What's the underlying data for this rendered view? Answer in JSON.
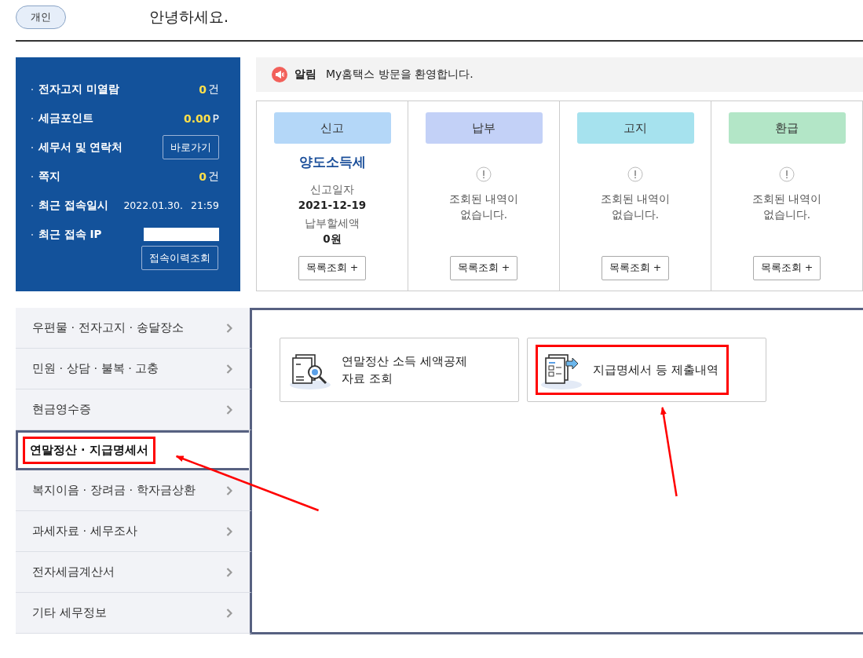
{
  "profile_tab": {
    "label": "개인",
    "selected": true
  },
  "greeting": "안녕하세요.",
  "summary": [
    {
      "kind": "count",
      "label": "전자고지 미열람",
      "value": "0",
      "unit": "건"
    },
    {
      "kind": "count",
      "label": "세금포인트",
      "value": "0.00",
      "unit": "P"
    },
    {
      "kind": "button",
      "label": "세무서 및 연락처",
      "button": "바로가기"
    },
    {
      "kind": "count",
      "label": "쪽지",
      "value": "0",
      "unit": "건"
    },
    {
      "kind": "datetime",
      "label": "최근 접속일시",
      "date": "2022.01.30.",
      "time": "21:59"
    },
    {
      "kind": "redacted",
      "label": "최근 접속 IP"
    }
  ],
  "history_button": "접속이력조회",
  "notice": {
    "label": "알림",
    "text": "My홈택스 방문을 환영합니다."
  },
  "cards": [
    {
      "kind": "filed",
      "header": "신고",
      "color": "#b4d7f8",
      "title": "양도소득세",
      "date_label": "신고일자",
      "date": "2021-12-19",
      "amount_label": "납부할세액",
      "amount": "0원",
      "button": "목록조회 +"
    },
    {
      "kind": "empty",
      "header": "납부",
      "color": "#c3d1f7",
      "message": "조회된 내역이 없습니다.",
      "button": "목록조회 +"
    },
    {
      "kind": "empty",
      "header": "고지",
      "color": "#a6e2ee",
      "message": "조회된 내역이 없습니다.",
      "button": "목록조회 +"
    },
    {
      "kind": "empty",
      "header": "환급",
      "color": "#b3e6c7",
      "message": "조회된 내역이 없습니다.",
      "button": "목록조회 +"
    }
  ],
  "sidebar": {
    "items": [
      {
        "label": "우편물 · 전자고지 · 송달장소",
        "selected": false,
        "highlighted": false
      },
      {
        "label": "민원 · 상담 · 불복 · 고충",
        "selected": false,
        "highlighted": false
      },
      {
        "label": "현금영수증",
        "selected": false,
        "highlighted": false
      },
      {
        "label": "연말정산 · 지급명세서",
        "selected": true,
        "highlighted": true
      },
      {
        "label": "복지이음 · 장려금 · 학자금상환",
        "selected": false,
        "highlighted": false
      },
      {
        "label": "과세자료 · 세무조사",
        "selected": false,
        "highlighted": false
      },
      {
        "label": "전자세금계산서",
        "selected": false,
        "highlighted": false
      },
      {
        "label": "기타 세무정보",
        "selected": false,
        "highlighted": false
      }
    ]
  },
  "tiles": [
    {
      "kind": "search",
      "label": "연말정산 소득 세액공제 자료 조회",
      "highlighted": false
    },
    {
      "kind": "submit",
      "label": "지급명세서 등 제출내역",
      "highlighted": true
    }
  ]
}
